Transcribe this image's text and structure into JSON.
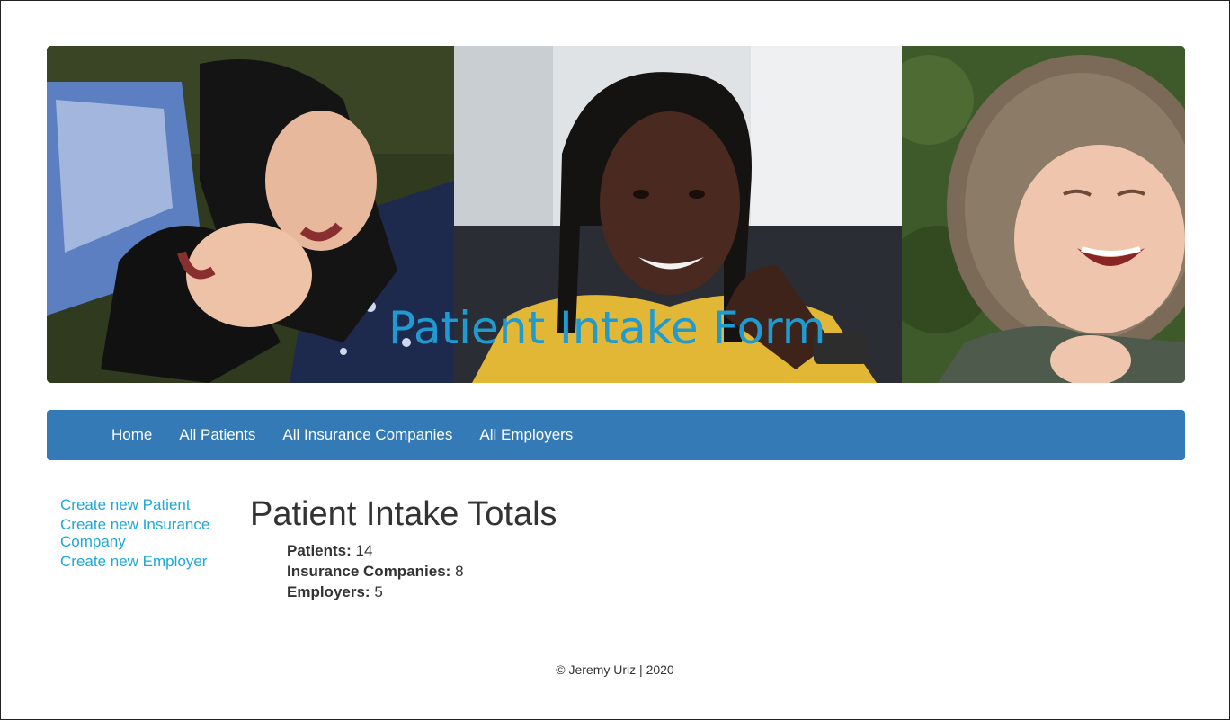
{
  "banner": {
    "title": "Patient Intake Form",
    "images": [
      "photo-two-women-laughing",
      "photo-woman-smiling-yellow-sweater",
      "photo-child-laughing-fur-hood"
    ]
  },
  "nav": {
    "items": [
      {
        "label": "Home"
      },
      {
        "label": "All Patients"
      },
      {
        "label": "All Insurance Companies"
      },
      {
        "label": "All Employers"
      }
    ]
  },
  "sidebar": {
    "links": [
      {
        "label": "Create new Patient"
      },
      {
        "label": "Create new Insurance Company"
      },
      {
        "label": "Create new Employer"
      }
    ]
  },
  "main": {
    "title": "Patient Intake Totals",
    "totals": [
      {
        "label": "Patients:",
        "value": "14"
      },
      {
        "label": "Insurance Companies:",
        "value": "8"
      },
      {
        "label": "Employers:",
        "value": "5"
      }
    ]
  },
  "footer": {
    "text": "© Jeremy Uriz | 2020"
  },
  "colors": {
    "navbar": "#337ab7",
    "link": "#1fa7d8",
    "banner_title": "#1f9bd1"
  }
}
